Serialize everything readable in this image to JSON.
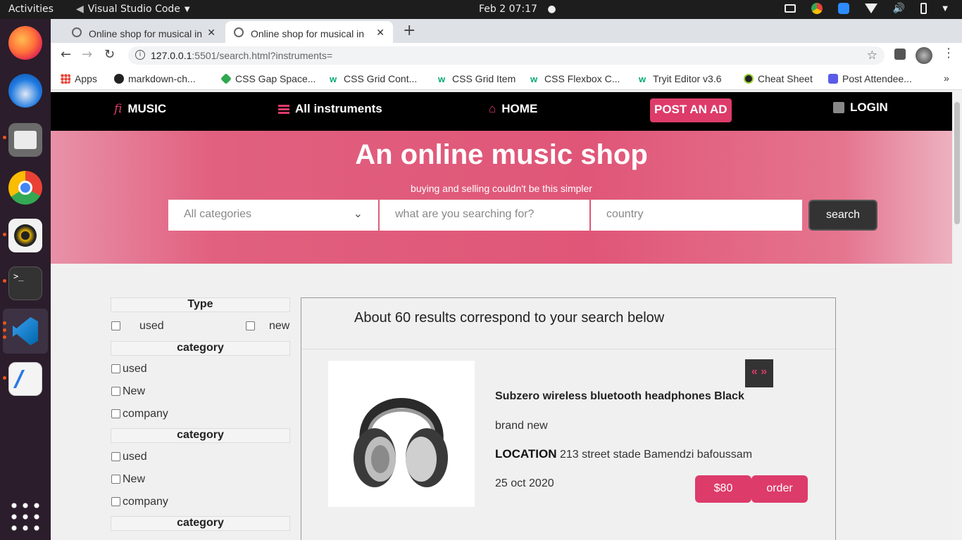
{
  "os": {
    "activities": "Activities",
    "app_name": "Visual Studio Code",
    "clock": "Feb 2  07:17"
  },
  "browser": {
    "tabs": [
      {
        "title": "Online shop for musical in"
      },
      {
        "title": "Online shop for musical in"
      }
    ],
    "url_host": "127.0.0.1",
    "url_rest": ":5501/search.html?instruments=",
    "bookmarks": [
      {
        "label": "Apps",
        "color": "#e94235"
      },
      {
        "label": "markdown-ch...",
        "color": "#222222"
      },
      {
        "label": "CSS Gap Space...",
        "color": "#2fa84f"
      },
      {
        "label": "CSS Grid Cont...",
        "color": "#04aa6d"
      },
      {
        "label": "CSS Grid Item",
        "color": "#04aa6d"
      },
      {
        "label": "CSS Flexbox C...",
        "color": "#04aa6d"
      },
      {
        "label": "Tryit Editor v3.6",
        "color": "#04aa6d"
      },
      {
        "label": "Cheat Sheet",
        "color": "#333333"
      },
      {
        "label": "Post Attendee...",
        "color": "#5b5be8"
      }
    ]
  },
  "nav": {
    "brand_mark": "fi",
    "brand": "MUSIC",
    "all": "All instruments",
    "home": "HOME",
    "post": "POST AN AD",
    "login": "LOGIN"
  },
  "hero": {
    "title": "An online music shop",
    "subtitle": "buying and selling couldn't be this simpler",
    "category": "All categories",
    "search_placeholder": "what are you searching for?",
    "country_placeholder": "country",
    "search_button": "search"
  },
  "filters": {
    "type_title": "Type",
    "type_used": "used",
    "type_new": "new",
    "groups": [
      {
        "title": "category",
        "options": [
          "used",
          "New",
          "company"
        ]
      },
      {
        "title": "category",
        "options": [
          "used",
          "New",
          "company"
        ]
      },
      {
        "title": "category",
        "options": []
      }
    ]
  },
  "results": {
    "summary": "About 60 results correspond to your search below",
    "item": {
      "name": "Subzero wireless bluetooth headphones Black",
      "condition": "brand new",
      "location_label": "LOCATION",
      "location": "213 street stade Bamendzi bafoussam",
      "date": "25 oct 2020",
      "price": "$80",
      "order": "order",
      "pager": "« »"
    }
  }
}
